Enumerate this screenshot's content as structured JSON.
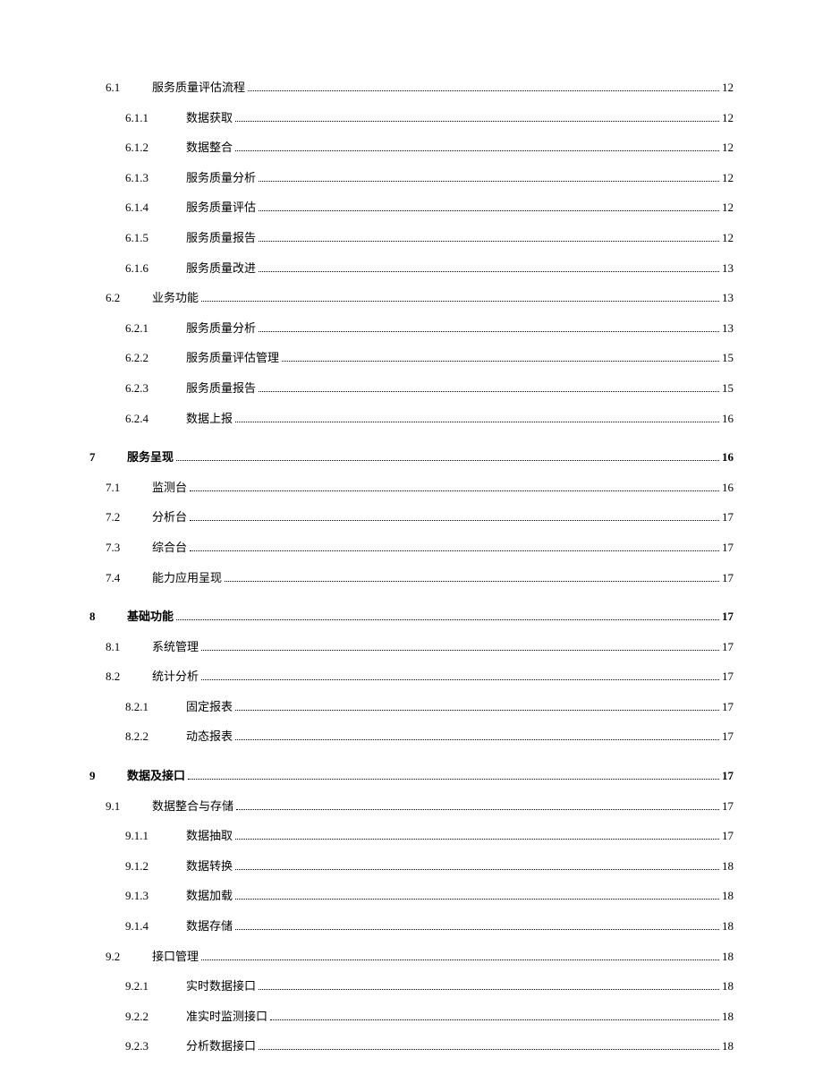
{
  "toc": [
    {
      "level": 2,
      "num": "6.1",
      "title": "服务质量评估流程",
      "page": "12"
    },
    {
      "level": 3,
      "num": "6.1.1",
      "title": "数据获取",
      "page": "12"
    },
    {
      "level": 3,
      "num": "6.1.2",
      "title": "数据整合",
      "page": "12"
    },
    {
      "level": 3,
      "num": "6.1.3",
      "title": "服务质量分析",
      "page": "12"
    },
    {
      "level": 3,
      "num": "6.1.4",
      "title": "服务质量评估",
      "page": "12"
    },
    {
      "level": 3,
      "num": "6.1.5",
      "title": "服务质量报告",
      "page": "12"
    },
    {
      "level": 3,
      "num": "6.1.6",
      "title": "服务质量改进",
      "page": "13"
    },
    {
      "level": 2,
      "num": "6.2",
      "title": "业务功能",
      "page": "13"
    },
    {
      "level": 3,
      "num": "6.2.1",
      "title": "服务质量分析",
      "page": "13"
    },
    {
      "level": 3,
      "num": "6.2.2",
      "title": "服务质量评估管理",
      "page": "15"
    },
    {
      "level": 3,
      "num": "6.2.3",
      "title": "服务质量报告",
      "page": "15"
    },
    {
      "level": 3,
      "num": "6.2.4",
      "title": "数据上报",
      "page": "16"
    },
    {
      "level": 1,
      "num": "7",
      "title": "服务呈现",
      "page": "16"
    },
    {
      "level": 2,
      "num": "7.1",
      "title": "监测台",
      "page": "16"
    },
    {
      "level": 2,
      "num": "7.2",
      "title": "分析台",
      "page": "17"
    },
    {
      "level": 2,
      "num": "7.3",
      "title": "综合台",
      "page": "17"
    },
    {
      "level": 2,
      "num": "7.4",
      "title": "能力应用呈现",
      "page": "17"
    },
    {
      "level": 1,
      "num": "8",
      "title": "基础功能",
      "page": "17"
    },
    {
      "level": 2,
      "num": "8.1",
      "title": "系统管理",
      "page": "17"
    },
    {
      "level": 2,
      "num": "8.2",
      "title": "统计分析",
      "page": "17"
    },
    {
      "level": 3,
      "num": "8.2.1",
      "title": "固定报表",
      "page": "17"
    },
    {
      "level": 3,
      "num": "8.2.2",
      "title": "动态报表",
      "page": "17"
    },
    {
      "level": 1,
      "num": "9",
      "title": "数据及接口",
      "page": "17"
    },
    {
      "level": 2,
      "num": "9.1",
      "title": "数据整合与存储",
      "page": "17"
    },
    {
      "level": 3,
      "num": "9.1.1",
      "title": "数据抽取",
      "page": "17"
    },
    {
      "level": 3,
      "num": "9.1.2",
      "title": "数据转换",
      "page": "18"
    },
    {
      "level": 3,
      "num": "9.1.3",
      "title": "数据加载",
      "page": "18"
    },
    {
      "level": 3,
      "num": "9.1.4",
      "title": "数据存储",
      "page": "18"
    },
    {
      "level": 2,
      "num": "9.2",
      "title": "接口管理",
      "page": "18"
    },
    {
      "level": 3,
      "num": "9.2.1",
      "title": "实时数据接口",
      "page": "18"
    },
    {
      "level": 3,
      "num": "9.2.2",
      "title": "准实时监测接口",
      "page": "18"
    },
    {
      "level": 3,
      "num": "9.2.3",
      "title": "分析数据接口",
      "page": "18"
    }
  ]
}
